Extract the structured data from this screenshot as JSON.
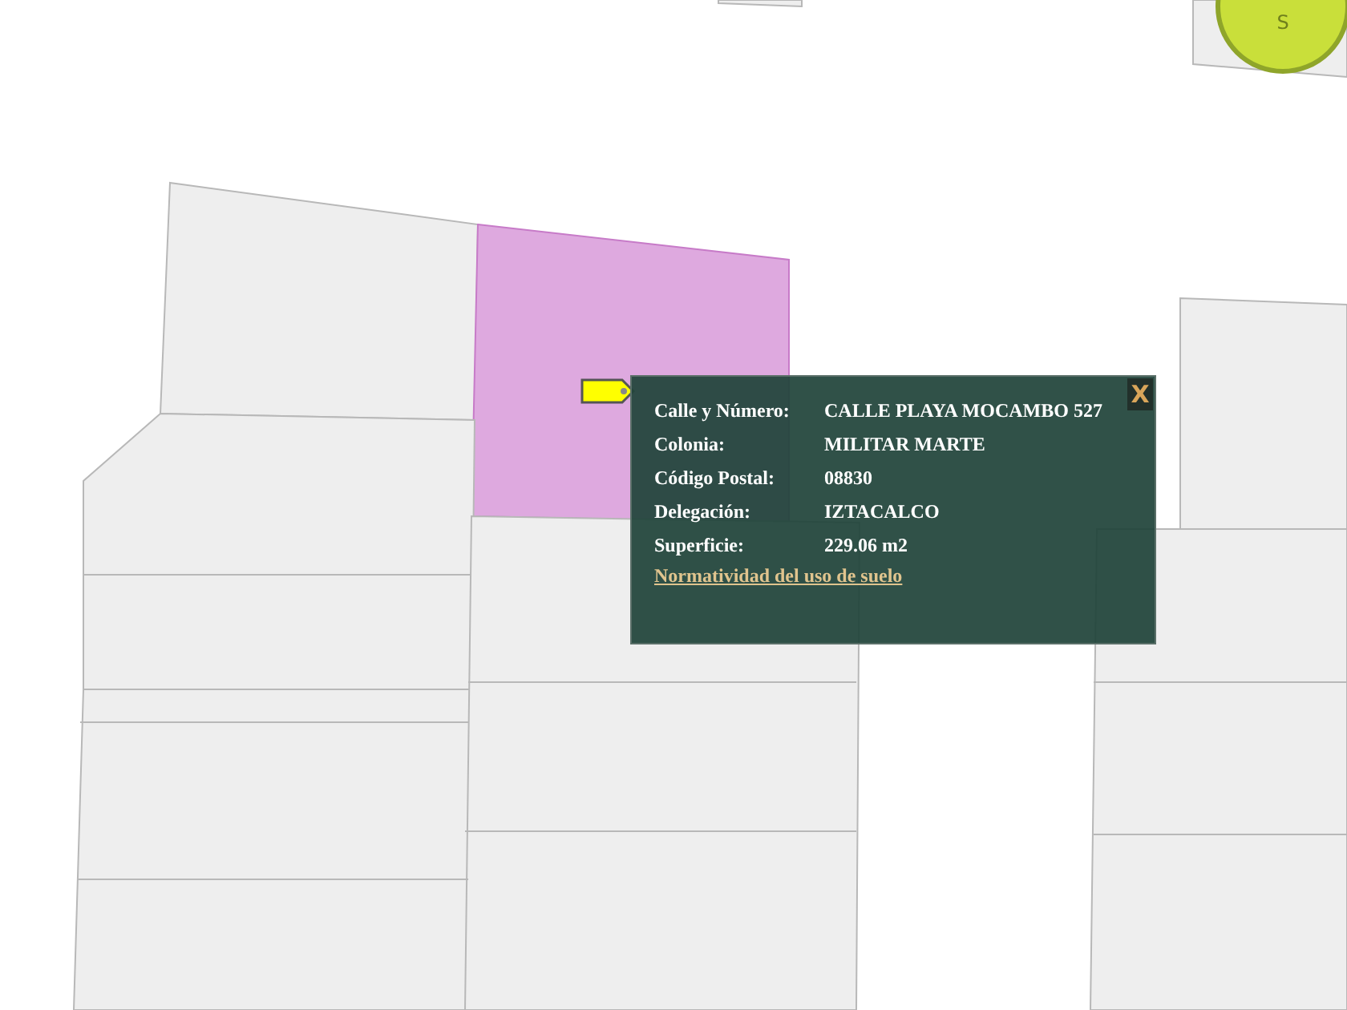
{
  "compass": {
    "label": "S"
  },
  "marker": {
    "kind": "tag"
  },
  "popup": {
    "close": "X",
    "fields": [
      {
        "label": "Calle y Número:",
        "value": "CALLE PLAYA MOCAMBO 527"
      },
      {
        "label": "Colonia:",
        "value": "MILITAR MARTE"
      },
      {
        "label": "Código Postal:",
        "value": "08830"
      },
      {
        "label": "Delegación:",
        "value": "IZTACALCO"
      },
      {
        "label": "Superficie:",
        "value": "229.06 m2"
      }
    ],
    "link": "Normatividad del uso de suelo"
  }
}
